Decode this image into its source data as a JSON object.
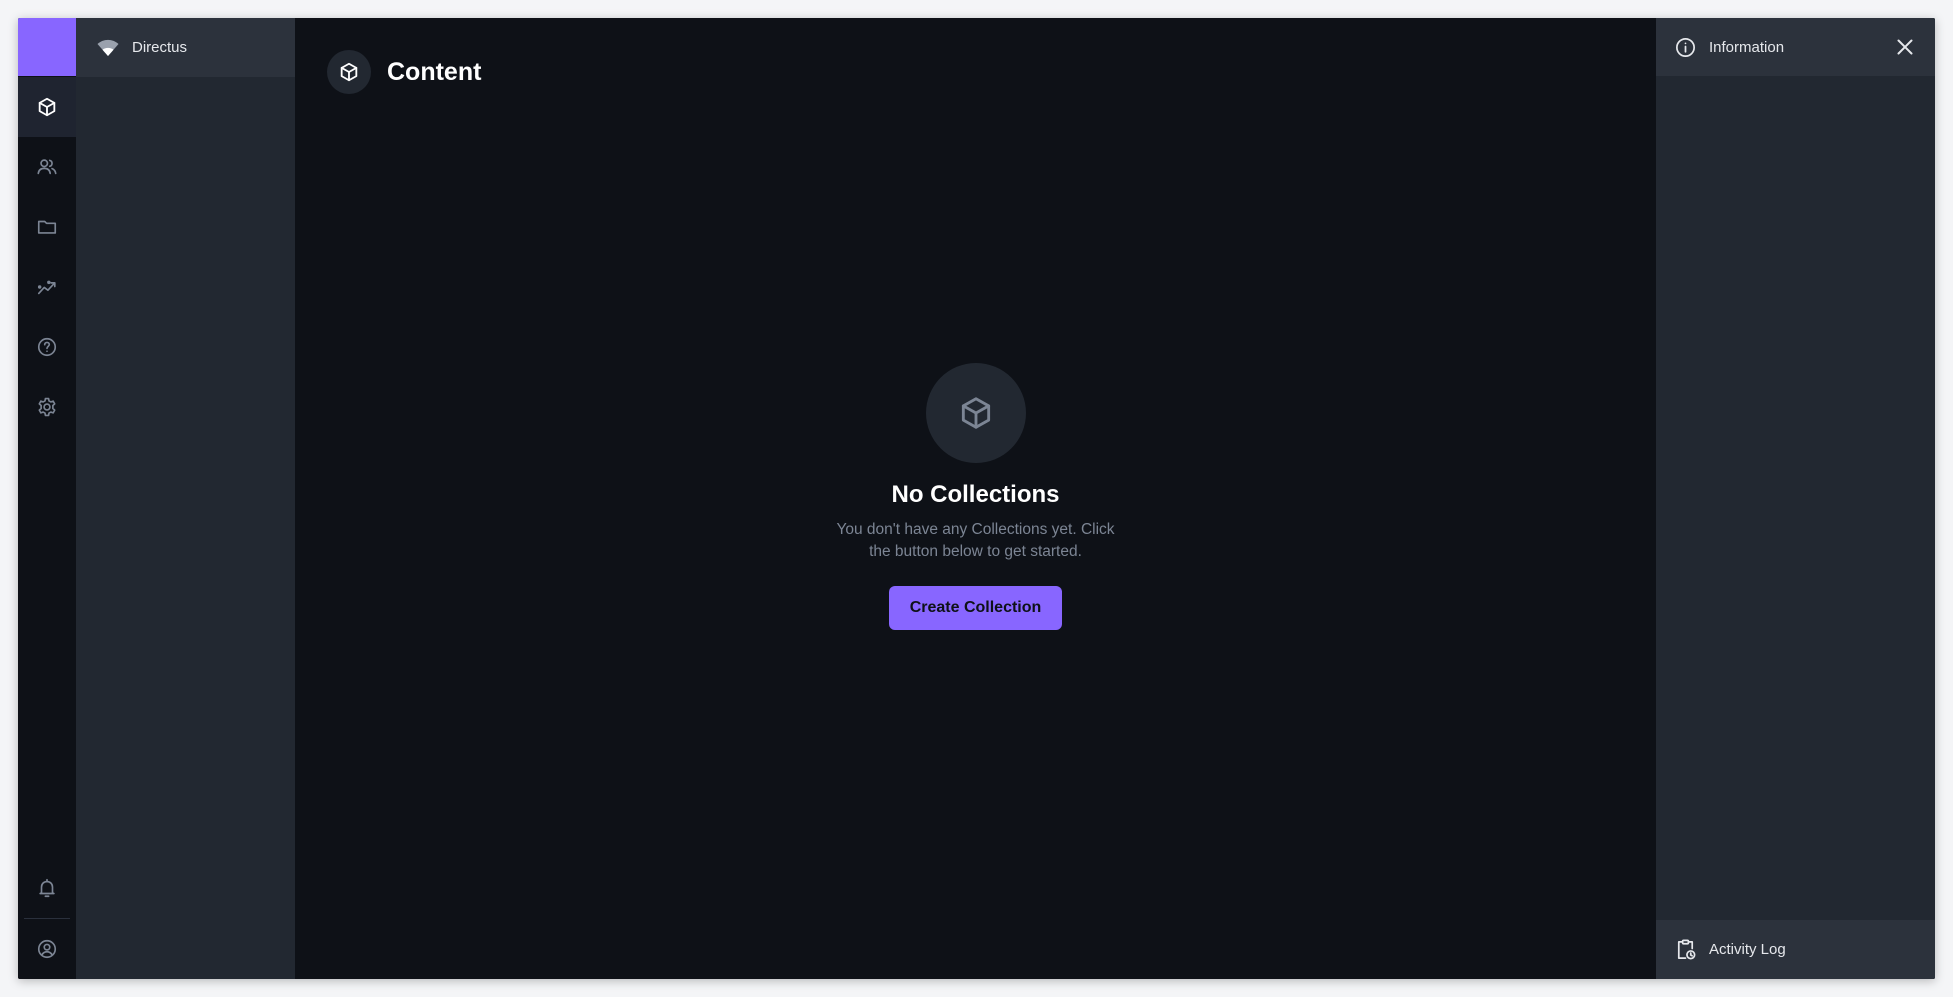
{
  "app": {
    "project_name": "Directus",
    "page_title": "Content"
  },
  "module_bar": {
    "items": [
      {
        "name": "content",
        "icon": "box-icon",
        "active": true
      },
      {
        "name": "users",
        "icon": "users-icon"
      },
      {
        "name": "files",
        "icon": "folder-icon"
      },
      {
        "name": "insights",
        "icon": "insights-icon"
      },
      {
        "name": "help",
        "icon": "help-icon"
      },
      {
        "name": "settings",
        "icon": "gear-icon"
      },
      {
        "name": "notifications",
        "icon": "bell-icon"
      },
      {
        "name": "user-menu",
        "icon": "account-circle-icon"
      }
    ]
  },
  "empty_state": {
    "title": "No Collections",
    "text": "You don't have any Collections yet. Click the button below to get started.",
    "button_label": "Create Collection"
  },
  "sidebar": {
    "title": "Information",
    "activity_label": "Activity Log"
  },
  "colors": {
    "accent": "#8866ff",
    "background": "#0e1117",
    "pane": "#222831",
    "header": "#2c323c",
    "muted_text": "#7c8594"
  }
}
